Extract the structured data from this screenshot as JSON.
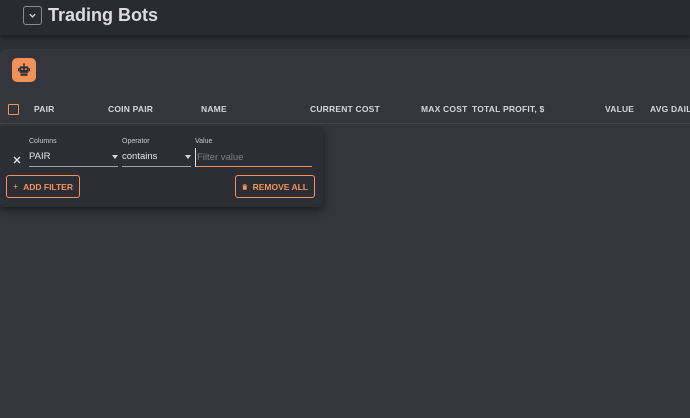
{
  "header": {
    "title": "Trading Bots",
    "collapse_icon": "chevron-down-icon"
  },
  "toolbar": {
    "bot_icon": "robot-icon",
    "accent": "#f0925a"
  },
  "table": {
    "columns": [
      "PAIR",
      "COIN PAIR",
      "NAME",
      "CURRENT COST",
      "MAX COST",
      "TOTAL PROFIT, $",
      "VALUE",
      "AVG DAILY"
    ]
  },
  "filter": {
    "columns_label": "Columns",
    "operator_label": "Operator",
    "value_label": "Value",
    "column_value": "PAIR",
    "operator_value": "contains",
    "value_placeholder": "Filter value",
    "add_filter_label": "ADD FILTER",
    "remove_all_label": "REMOVE ALL"
  }
}
